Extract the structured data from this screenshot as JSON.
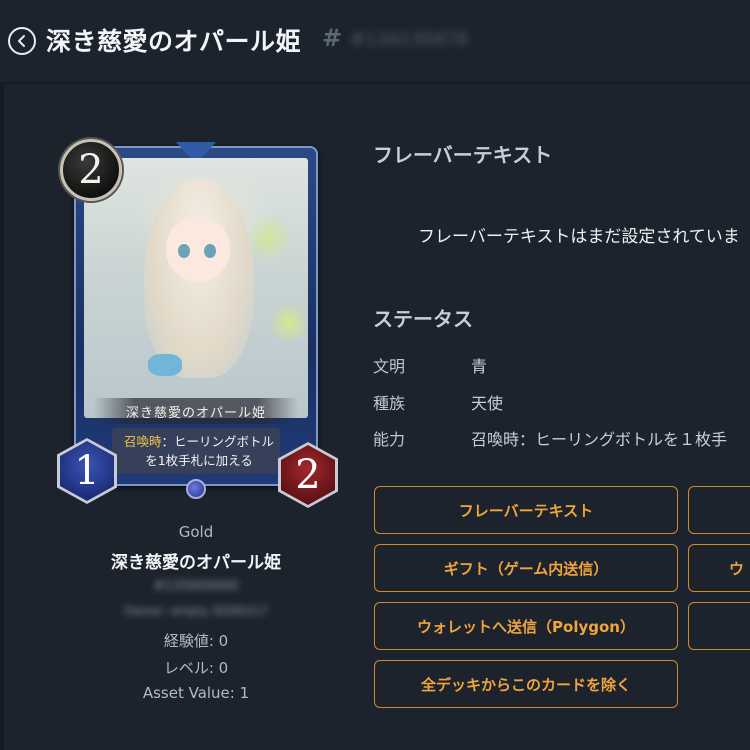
{
  "header": {
    "title": "深き慈愛のオパール姫",
    "hash": "#",
    "id_blurred": "#134130478"
  },
  "card": {
    "cost": "2",
    "attack": "1",
    "hp": "2",
    "name": "深き慈愛のオパール姫",
    "ability_keyword": "召喚時",
    "ability_text_line1": "：ヒーリングボトル",
    "ability_text_line2": "を1枚手札に加える"
  },
  "card_info": {
    "rarity": "Gold",
    "title": "深き慈愛のオパール姫",
    "serial_blurred": "#135600000",
    "owner_blurred": "Owner: empty 0D0EA17",
    "exp": "経験値: 0",
    "level": "レベル: 0",
    "asset_value": "Asset Value: 1"
  },
  "flavor": {
    "heading": "フレーバーテキスト",
    "text": "フレーバーテキストはまだ設定されていま"
  },
  "status": {
    "heading": "ステータス",
    "rows": [
      {
        "label": "文明",
        "value": "青"
      },
      {
        "label": "種族",
        "value": "天使"
      },
      {
        "label": "能力",
        "value": "召喚時：ヒーリングボトルを１枚手"
      }
    ]
  },
  "actions": {
    "flavor_button": "フレーバーテキスト",
    "gift_button": "ギフト（ゲーム内送信）",
    "wallet_button": "ウォレットへ送信（Polygon）",
    "remove_button": "全デッキからこのカードを除く",
    "right_button_2": "ウ"
  },
  "colors": {
    "accent": "#f0a43a",
    "background": "#151b22",
    "panel": "#1c232d"
  }
}
